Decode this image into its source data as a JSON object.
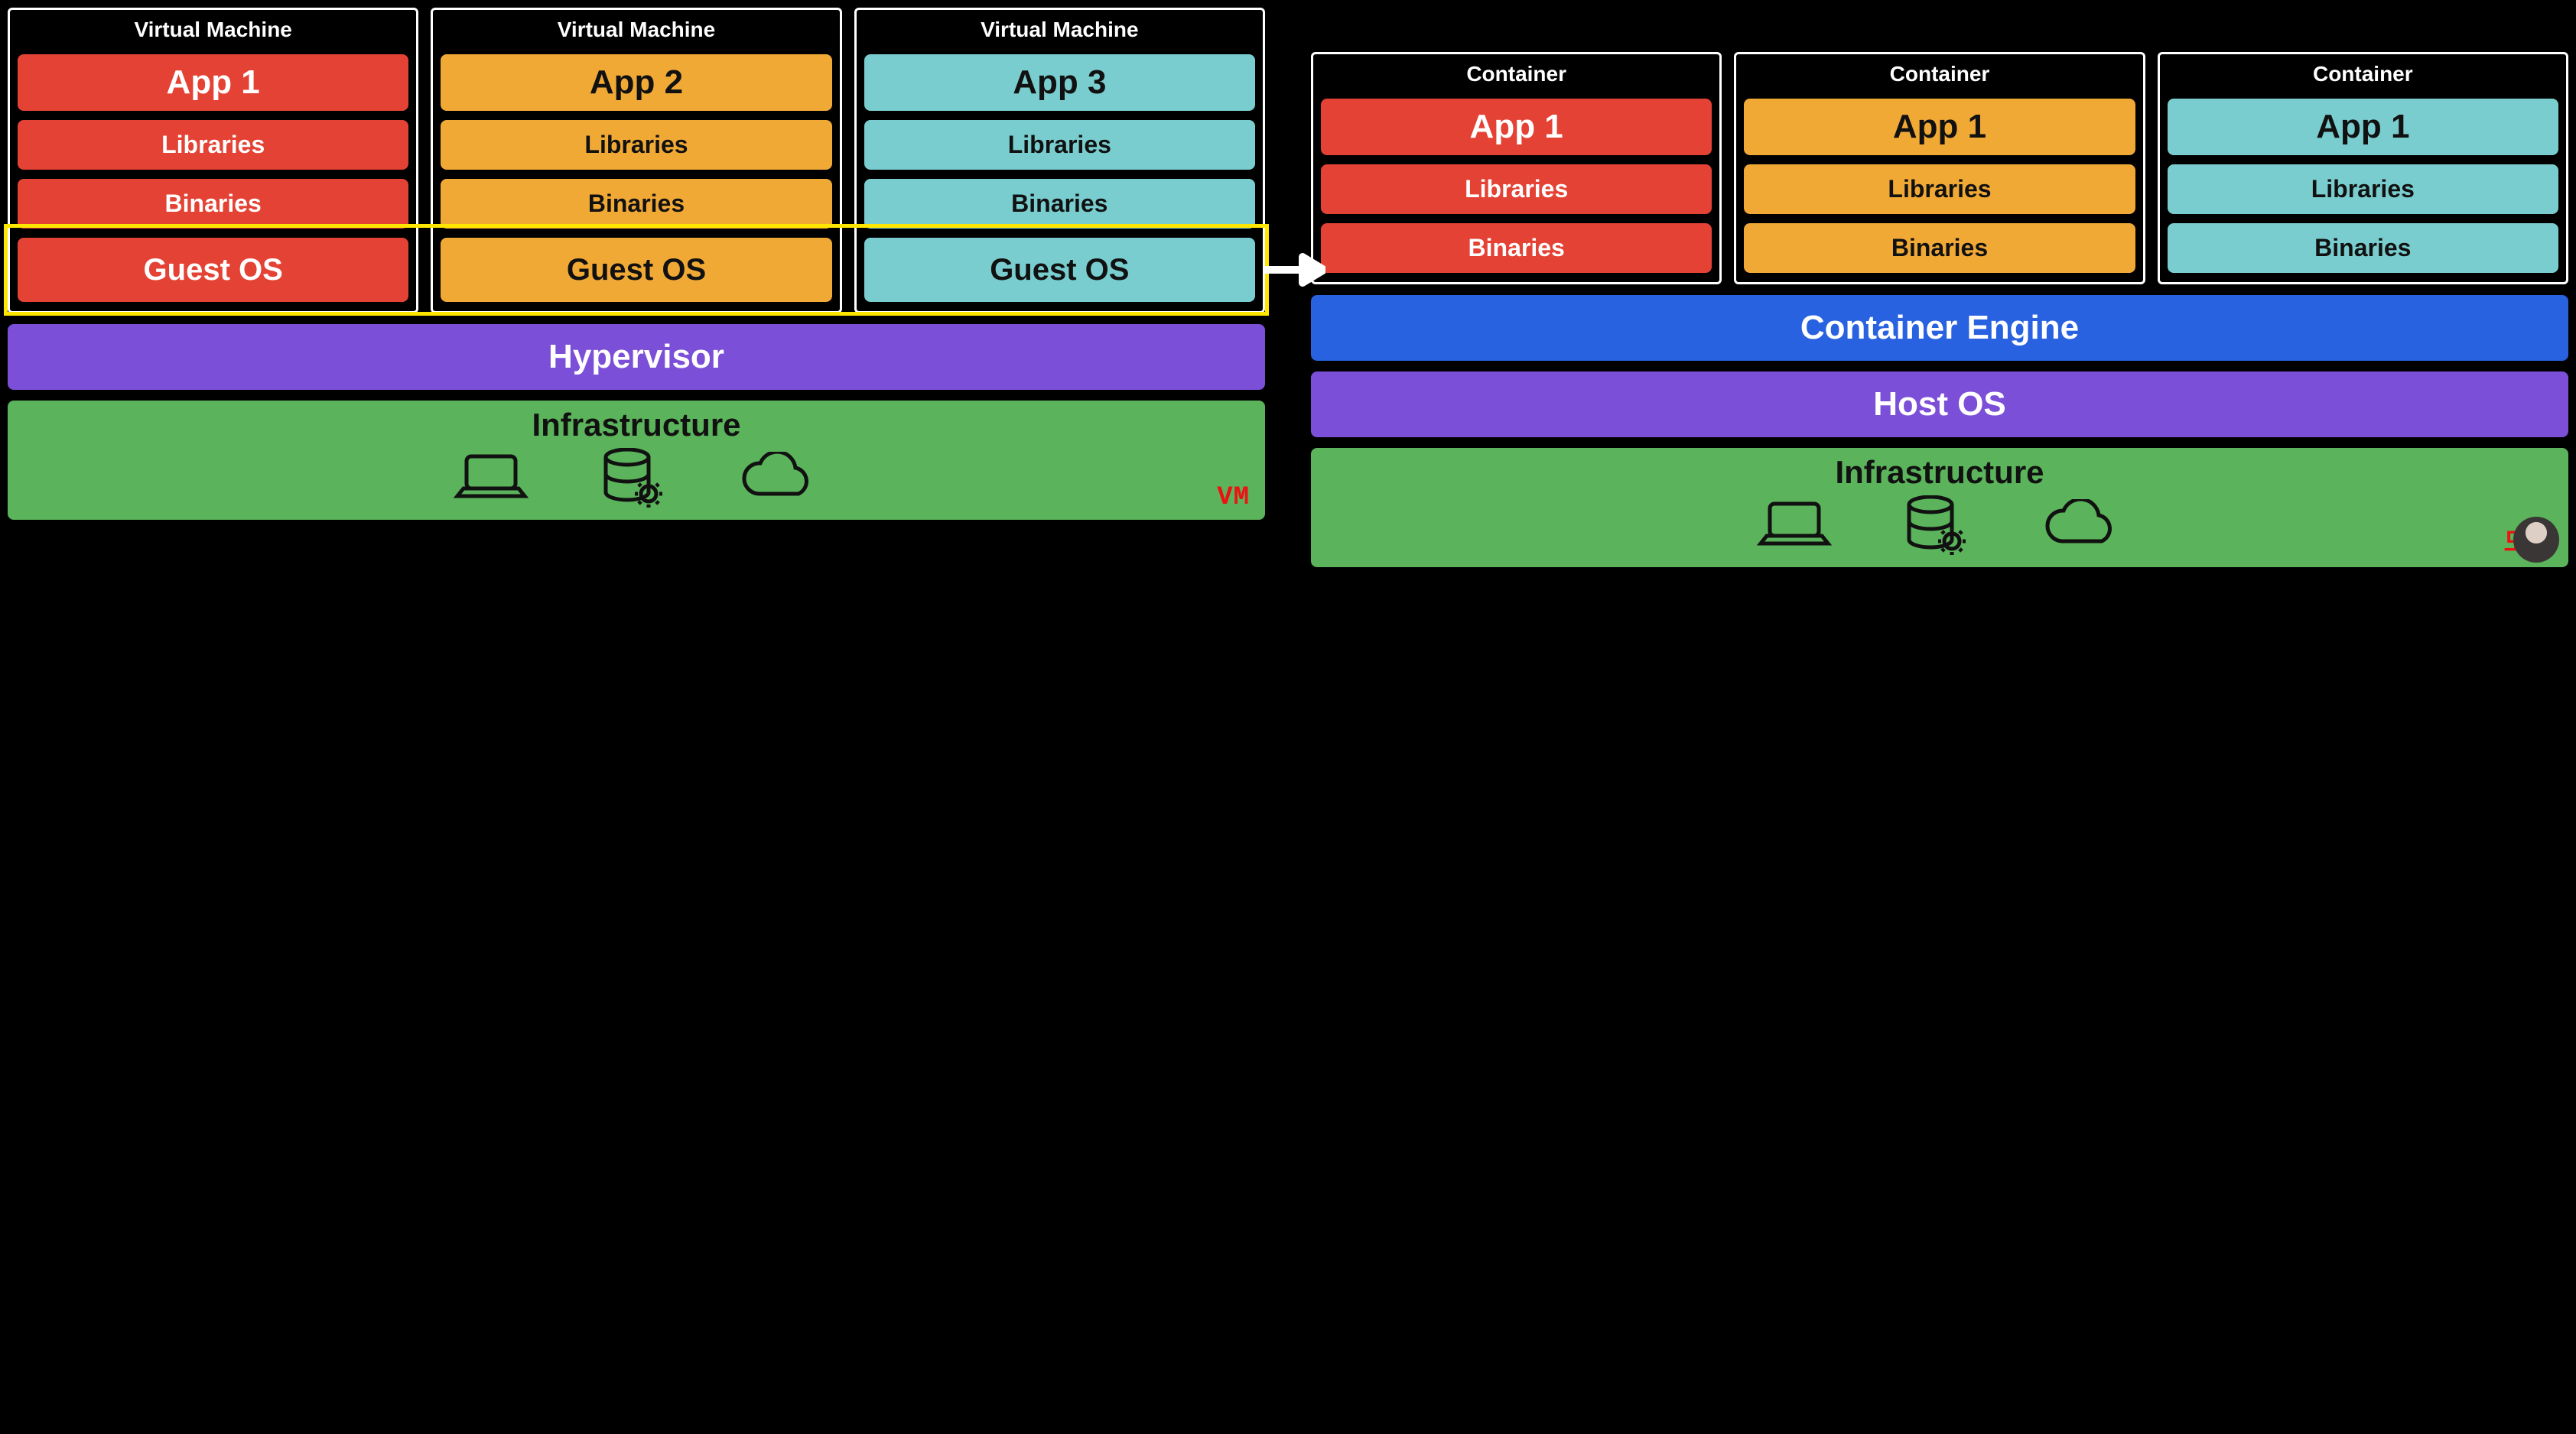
{
  "left": {
    "columns": [
      {
        "title": "Virtual Machine",
        "colorClass": "red",
        "app": "App 1",
        "libs": "Libraries",
        "bins": "Binaries",
        "guest": "Guest OS"
      },
      {
        "title": "Virtual Machine",
        "colorClass": "orange",
        "app": "App 2",
        "libs": "Libraries",
        "bins": "Binaries",
        "guest": "Guest OS"
      },
      {
        "title": "Virtual Machine",
        "colorClass": "cyan",
        "app": "App 3",
        "libs": "Libraries",
        "bins": "Binaries",
        "guest": "Guest OS"
      }
    ],
    "hypervisor": "Hypervisor",
    "infrastructure": "Infrastructure",
    "tag": "VM"
  },
  "right": {
    "columns": [
      {
        "title": "Container",
        "colorClass": "red",
        "app": "App 1",
        "libs": "Libraries",
        "bins": "Binaries"
      },
      {
        "title": "Container",
        "colorClass": "orange",
        "app": "App 1",
        "libs": "Libraries",
        "bins": "Binaries"
      },
      {
        "title": "Container",
        "colorClass": "cyan",
        "app": "App 1",
        "libs": "Libraries",
        "bins": "Binaries"
      }
    ],
    "container_engine": "Container Engine",
    "host_os": "Host OS",
    "infrastructure": "Infrastructure",
    "tag": "도커"
  },
  "highlight": {
    "target": "Guest OS row"
  },
  "icons": {
    "laptop": "laptop-icon",
    "db": "database-gear-icon",
    "cloud": "cloud-icon"
  }
}
